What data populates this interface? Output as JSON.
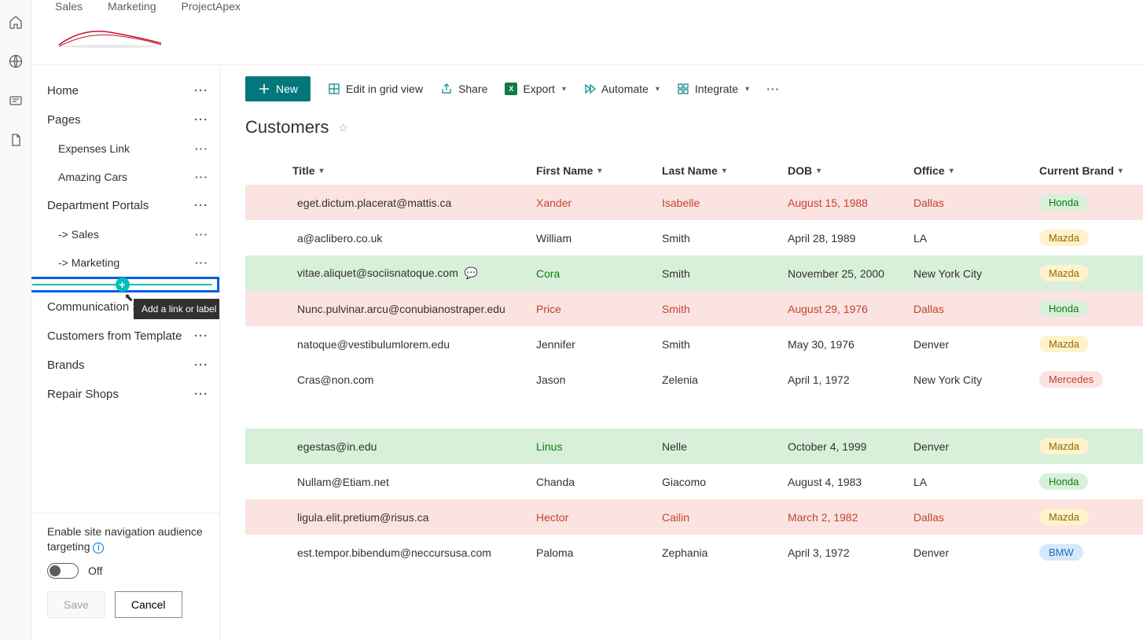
{
  "hubTabs": [
    "Sales",
    "Marketing",
    "ProjectApex"
  ],
  "sidebar": {
    "items": [
      {
        "label": "Home",
        "child": false
      },
      {
        "label": "Pages",
        "child": false
      },
      {
        "label": "Expenses Link",
        "child": true
      },
      {
        "label": "Amazing Cars",
        "child": true
      },
      {
        "label": "Department Portals",
        "child": false
      },
      {
        "label": "-> Sales",
        "child": true
      },
      {
        "label": "-> Marketing",
        "child": true
      },
      {
        "label": "Communication Site",
        "child": false
      },
      {
        "label": "Customers from Template",
        "child": false
      },
      {
        "label": "Brands",
        "child": false
      },
      {
        "label": "Repair Shops",
        "child": false
      }
    ],
    "tooltip": "Add a link or label to navigation",
    "audience": {
      "label": "Enable site navigation audience targeting",
      "state": "Off",
      "save": "Save",
      "cancel": "Cancel"
    }
  },
  "commandBar": {
    "new": "New",
    "grid": "Edit in grid view",
    "share": "Share",
    "export": "Export",
    "automate": "Automate",
    "integrate": "Integrate"
  },
  "pageTitle": "Customers",
  "columns": [
    "Title",
    "First Name",
    "Last Name",
    "DOB",
    "Office",
    "Current Brand"
  ],
  "rows": [
    {
      "style": "pink",
      "title": "eget.dictum.placerat@mattis.ca",
      "fn": "Xander",
      "ln": "Isabelle",
      "dob": "August 15, 1988",
      "office": "Dallas",
      "brand": "Honda",
      "brandClass": "honda",
      "comment": false
    },
    {
      "style": "",
      "title": "a@aclibero.co.uk",
      "fn": "William",
      "ln": "Smith",
      "dob": "April 28, 1989",
      "office": "LA",
      "brand": "Mazda",
      "brandClass": "mazda",
      "comment": false
    },
    {
      "style": "green",
      "title": "vitae.aliquet@sociisnatoque.com",
      "fn": "Cora",
      "ln": "Smith",
      "dob": "November 25, 2000",
      "office": "New York City",
      "brand": "Mazda",
      "brandClass": "mazda",
      "comment": true
    },
    {
      "style": "pink",
      "title": "Nunc.pulvinar.arcu@conubianostraper.edu",
      "fn": "Price",
      "ln": "Smith",
      "dob": "August 29, 1976",
      "office": "Dallas",
      "brand": "Honda",
      "brandClass": "honda",
      "comment": false
    },
    {
      "style": "",
      "title": "natoque@vestibulumlorem.edu",
      "fn": "Jennifer",
      "ln": "Smith",
      "dob": "May 30, 1976",
      "office": "Denver",
      "brand": "Mazda",
      "brandClass": "mazda",
      "comment": false
    },
    {
      "style": "",
      "title": "Cras@non.com",
      "fn": "Jason",
      "ln": "Zelenia",
      "dob": "April 1, 1972",
      "office": "New York City",
      "brand": "Mercedes",
      "brandClass": "mercedes",
      "comment": false
    },
    {
      "style": "spacer"
    },
    {
      "style": "green",
      "title": "egestas@in.edu",
      "fn": "Linus",
      "ln": "Nelle",
      "dob": "October 4, 1999",
      "office": "Denver",
      "brand": "Mazda",
      "brandClass": "mazda",
      "comment": false
    },
    {
      "style": "",
      "title": "Nullam@Etiam.net",
      "fn": "Chanda",
      "ln": "Giacomo",
      "dob": "August 4, 1983",
      "office": "LA",
      "brand": "Honda",
      "brandClass": "honda",
      "comment": false
    },
    {
      "style": "pink",
      "title": "ligula.elit.pretium@risus.ca",
      "fn": "Hector",
      "ln": "Cailin",
      "dob": "March 2, 1982",
      "office": "Dallas",
      "brand": "Mazda",
      "brandClass": "mazda",
      "comment": false
    },
    {
      "style": "",
      "title": "est.tempor.bibendum@neccursusa.com",
      "fn": "Paloma",
      "ln": "Zephania",
      "dob": "April 3, 1972",
      "office": "Denver",
      "brand": "BMW",
      "brandClass": "bmw",
      "comment": false
    }
  ]
}
